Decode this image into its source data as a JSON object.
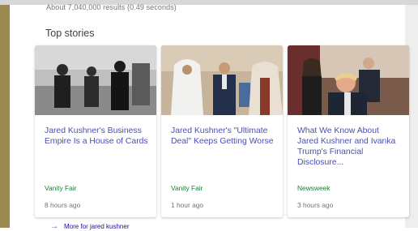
{
  "search": {
    "results_count": "About 7,040,000 results (0.49 seconds)"
  },
  "top_stories": {
    "title": "Top stories",
    "cards": [
      {
        "headline": "Jared Kushner's Business Empire Is a House of Cards",
        "source": "Vanity Fair",
        "time": "8 hours ago"
      },
      {
        "headline": "Jared Kushner's \"Ultimate Deal\" Keeps Getting Worse",
        "source": "Vanity Fair",
        "time": "1 hour ago"
      },
      {
        "headline": "What We Know About Jared Kushner and Ivanka Trump's Financial Disclosure...",
        "source": "Newsweek",
        "time": "3 hours ago"
      }
    ],
    "more_link": "More for jared kushner"
  },
  "colors": {
    "headline": "#4b4fb0",
    "source": "#1a7d36",
    "meta": "#70757a"
  },
  "icons": {
    "more_link": "arrow-right-icon"
  }
}
